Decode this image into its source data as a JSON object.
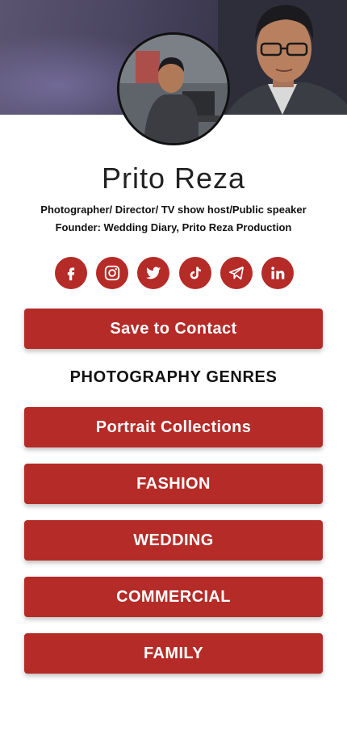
{
  "profile": {
    "name": "Prito Reza",
    "tagline_1": "Photographer/ Director/ TV show host/Public speaker",
    "tagline_2": "Founder: Wedding Diary, Prito Reza Production"
  },
  "socials": [
    {
      "icon": "facebook-icon"
    },
    {
      "icon": "instagram-icon"
    },
    {
      "icon": "twitter-icon"
    },
    {
      "icon": "tiktok-icon"
    },
    {
      "icon": "telegram-icon"
    },
    {
      "icon": "linkedin-icon"
    }
  ],
  "actions": {
    "save_label": "Save to Contact"
  },
  "genres": {
    "title": "PHOTOGRAPHY GENRES",
    "items": [
      {
        "label": "Portrait Collections"
      },
      {
        "label": "FASHION"
      },
      {
        "label": "WEDDING"
      },
      {
        "label": "COMMERCIAL"
      },
      {
        "label": "FAMILY"
      }
    ]
  },
  "colors": {
    "accent": "#b52b27",
    "button_text": "#ffffff",
    "background": "#ffffff"
  }
}
